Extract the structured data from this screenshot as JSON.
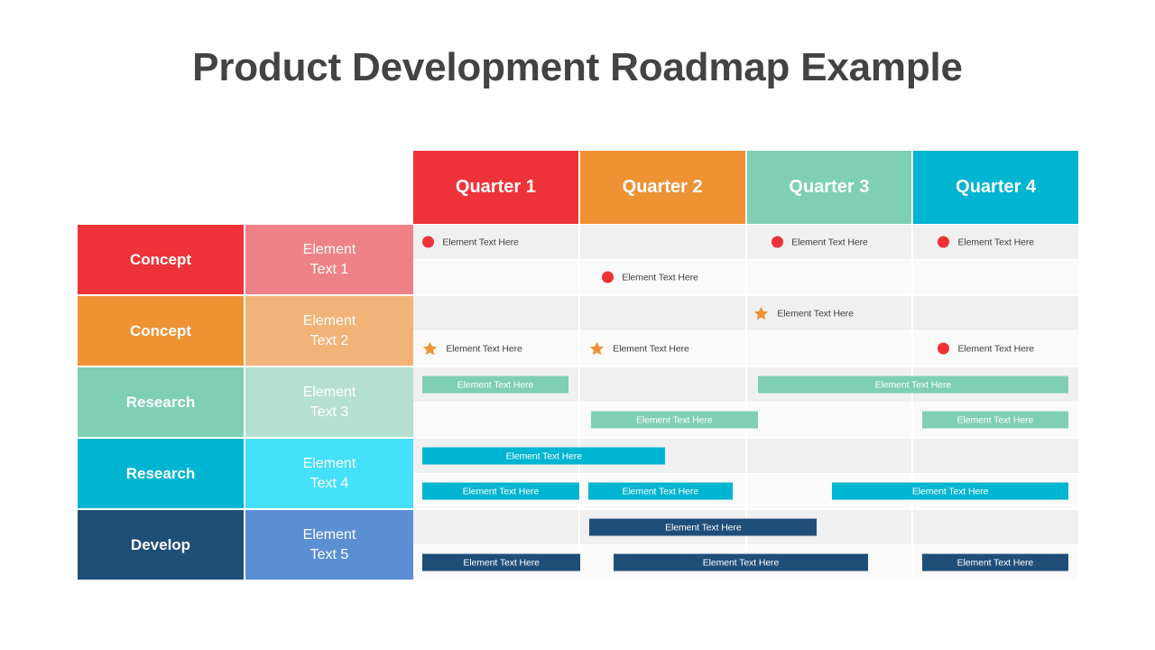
{
  "slide": {
    "title": "Product Development Roadmap Example",
    "title_color": "#434343",
    "background": "#ffffff"
  },
  "columns": [
    {
      "label": "Quarter 1",
      "color": "#ee3338"
    },
    {
      "label": "Quarter 2",
      "color": "#ee9234"
    },
    {
      "label": "Quarter 3",
      "color": "#7ecfb4"
    },
    {
      "label": "Quarter 4",
      "color": "#00b5d1"
    }
  ],
  "rows": [
    {
      "stage": "Concept",
      "element": "Element\nText 1",
      "stage_color": "#ee3338",
      "element_color": "#ef8288"
    },
    {
      "stage": "Concept",
      "element": "Element\nText 2",
      "stage_color": "#ee9234",
      "element_color": "#f2b378"
    },
    {
      "stage": "Research",
      "element": "Element\nText 3",
      "stage_color": "#7ecfb4",
      "element_color": "#b4e0d1"
    },
    {
      "stage": "Research",
      "element": "Element\nText 4",
      "stage_color": "#00b5d1",
      "element_color": "#45e0fb"
    },
    {
      "stage": "Develop",
      "element": "Element\nText 5",
      "stage_color": "#1f4e79",
      "element_color": "#5b8fd4"
    }
  ],
  "marker_colors": {
    "dot": "#ee3338",
    "star": "#ee9234"
  },
  "bar_colors": {
    "teal": "#7ecfb4",
    "cyan": "#00b5d1",
    "navy": "#1f4e79"
  },
  "item_label": "Element Text Here",
  "chart_data": {
    "type": "table",
    "title": "Product Development Roadmap Example",
    "categories": [
      "Quarter 1",
      "Quarter 2",
      "Quarter 3",
      "Quarter 4"
    ],
    "rows": [
      "Element Text 1",
      "Element Text 2",
      "Element Text 3",
      "Element Text 4",
      "Element Text 5"
    ],
    "items": [
      {
        "row": 0,
        "subrow": 0,
        "kind": "dot",
        "start_pct": 1.4,
        "end_pct": 1.4,
        "label": "Element Text Here"
      },
      {
        "row": 0,
        "subrow": 0,
        "kind": "dot",
        "start_pct": 53.9,
        "end_pct": 53.9,
        "label": "Element Text Here"
      },
      {
        "row": 0,
        "subrow": 0,
        "kind": "dot",
        "start_pct": 78.9,
        "end_pct": 78.9,
        "label": "Element Text Here"
      },
      {
        "row": 0,
        "subrow": 1,
        "kind": "dot",
        "start_pct": 28.4,
        "end_pct": 28.4,
        "label": "Element Text Here"
      },
      {
        "row": 1,
        "subrow": 0,
        "kind": "star",
        "start_pct": 51.2,
        "end_pct": 51.2,
        "label": "Element Text Here"
      },
      {
        "row": 1,
        "subrow": 1,
        "kind": "star",
        "start_pct": 1.4,
        "end_pct": 1.4,
        "label": "Element Text Here"
      },
      {
        "row": 1,
        "subrow": 1,
        "kind": "star",
        "start_pct": 26.5,
        "end_pct": 26.5,
        "label": "Element Text Here"
      },
      {
        "row": 1,
        "subrow": 1,
        "kind": "dot",
        "start_pct": 78.9,
        "end_pct": 78.9,
        "label": "Element Text Here"
      },
      {
        "row": 2,
        "subrow": 0,
        "kind": "bar-teal",
        "start_pct": 1.4,
        "end_pct": 23.3,
        "label": "Element Text Here"
      },
      {
        "row": 2,
        "subrow": 0,
        "kind": "bar-teal",
        "start_pct": 51.8,
        "end_pct": 98.5,
        "label": "Element Text Here"
      },
      {
        "row": 2,
        "subrow": 1,
        "kind": "bar-teal",
        "start_pct": 26.7,
        "end_pct": 51.8,
        "label": "Element Text Here"
      },
      {
        "row": 2,
        "subrow": 1,
        "kind": "bar-teal",
        "start_pct": 76.5,
        "end_pct": 98.5,
        "label": "Element Text Here"
      },
      {
        "row": 3,
        "subrow": 0,
        "kind": "bar-cyan",
        "start_pct": 1.4,
        "end_pct": 37.9,
        "label": "Element Text Here"
      },
      {
        "row": 3,
        "subrow": 1,
        "kind": "bar-cyan",
        "start_pct": 1.4,
        "end_pct": 24.9,
        "label": "Element Text Here"
      },
      {
        "row": 3,
        "subrow": 1,
        "kind": "bar-cyan",
        "start_pct": 26.3,
        "end_pct": 48.0,
        "label": "Element Text Here"
      },
      {
        "row": 3,
        "subrow": 1,
        "kind": "bar-cyan",
        "start_pct": 63.0,
        "end_pct": 98.5,
        "label": "Element Text Here"
      },
      {
        "row": 4,
        "subrow": 0,
        "kind": "bar-navy",
        "start_pct": 26.5,
        "end_pct": 60.7,
        "label": "Element Text Here"
      },
      {
        "row": 4,
        "subrow": 1,
        "kind": "bar-navy",
        "start_pct": 1.4,
        "end_pct": 25.1,
        "label": "Element Text Here"
      },
      {
        "row": 4,
        "subrow": 1,
        "kind": "bar-navy",
        "start_pct": 30.1,
        "end_pct": 68.4,
        "label": "Element Text Here"
      },
      {
        "row": 4,
        "subrow": 1,
        "kind": "bar-navy",
        "start_pct": 76.5,
        "end_pct": 98.5,
        "label": "Element Text Here"
      }
    ]
  }
}
